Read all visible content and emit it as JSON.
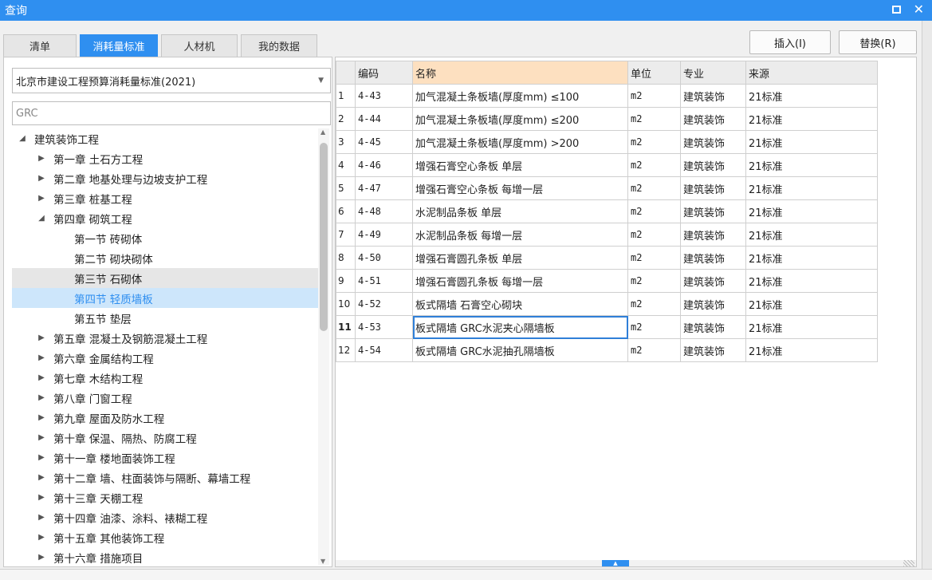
{
  "window": {
    "title": "查询"
  },
  "tabs": [
    {
      "label": "清单"
    },
    {
      "label": "消耗量标准"
    },
    {
      "label": "人材机"
    },
    {
      "label": "我的数据"
    }
  ],
  "buttons": {
    "insert": "插入(I)",
    "replace": "替换(R)"
  },
  "left": {
    "standard_select": "北京市建设工程预算消耗量标准(2021)",
    "search_value": "GRC",
    "tree": [
      {
        "label": "建筑装饰工程",
        "level": 0,
        "expanded": true
      },
      {
        "label": "第一章 土石方工程",
        "level": 1
      },
      {
        "label": "第二章 地基处理与边坡支护工程",
        "level": 1
      },
      {
        "label": "第三章 桩基工程",
        "level": 1
      },
      {
        "label": "第四章 砌筑工程",
        "level": 1,
        "expanded": true
      },
      {
        "label": "第一节 砖砌体",
        "level": 2
      },
      {
        "label": "第二节 砌块砌体",
        "level": 2
      },
      {
        "label": "第三节 石砌体",
        "level": 2
      },
      {
        "label": "第四节 轻质墙板",
        "level": 2
      },
      {
        "label": "第五节 垫层",
        "level": 2
      },
      {
        "label": "第五章 混凝土及钢筋混凝土工程",
        "level": 1
      },
      {
        "label": "第六章 金属结构工程",
        "level": 1
      },
      {
        "label": "第七章 木结构工程",
        "level": 1
      },
      {
        "label": "第八章 门窗工程",
        "level": 1
      },
      {
        "label": "第九章 屋面及防水工程",
        "level": 1
      },
      {
        "label": "第十章 保温、隔热、防腐工程",
        "level": 1
      },
      {
        "label": "第十一章 楼地面装饰工程",
        "level": 1
      },
      {
        "label": "第十二章 墙、柱面装饰与隔断、幕墙工程",
        "level": 1
      },
      {
        "label": "第十三章 天棚工程",
        "level": 1
      },
      {
        "label": "第十四章 油漆、涂料、裱糊工程",
        "level": 1
      },
      {
        "label": "第十五章 其他装饰工程",
        "level": 1
      },
      {
        "label": "第十六章 措施项目",
        "level": 1
      }
    ]
  },
  "table": {
    "headers": [
      "编码",
      "名称",
      "单位",
      "专业",
      "来源"
    ],
    "rows": [
      [
        "1",
        "4-43",
        "加气混凝土条板墙(厚度mm) ≤100",
        "m2",
        "建筑装饰",
        "21标准"
      ],
      [
        "2",
        "4-44",
        "加气混凝土条板墙(厚度mm) ≤200",
        "m2",
        "建筑装饰",
        "21标准"
      ],
      [
        "3",
        "4-45",
        "加气混凝土条板墙(厚度mm) >200",
        "m2",
        "建筑装饰",
        "21标准"
      ],
      [
        "4",
        "4-46",
        "增强石膏空心条板 单层",
        "m2",
        "建筑装饰",
        "21标准"
      ],
      [
        "5",
        "4-47",
        "增强石膏空心条板 每增一层",
        "m2",
        "建筑装饰",
        "21标准"
      ],
      [
        "6",
        "4-48",
        "水泥制品条板 单层",
        "m2",
        "建筑装饰",
        "21标准"
      ],
      [
        "7",
        "4-49",
        "水泥制品条板 每增一层",
        "m2",
        "建筑装饰",
        "21标准"
      ],
      [
        "8",
        "4-50",
        "增强石膏圆孔条板 单层",
        "m2",
        "建筑装饰",
        "21标准"
      ],
      [
        "9",
        "4-51",
        "增强石膏圆孔条板 每增一层",
        "m2",
        "建筑装饰",
        "21标准"
      ],
      [
        "10",
        "4-52",
        "板式隔墙 石膏空心砌块",
        "m2",
        "建筑装饰",
        "21标准"
      ],
      [
        "11",
        "4-53",
        "板式隔墙 GRC水泥夹心隔墙板",
        "m2",
        "建筑装饰",
        "21标准"
      ],
      [
        "12",
        "4-54",
        "板式隔墙 GRC水泥抽孔隔墙板",
        "m2",
        "建筑装饰",
        "21标准"
      ]
    ]
  }
}
